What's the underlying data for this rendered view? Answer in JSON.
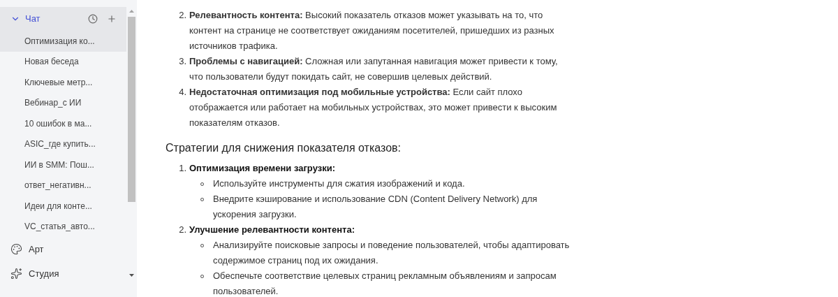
{
  "sidebar": {
    "chat": {
      "label": "Чат",
      "expanded": true,
      "items": [
        {
          "label": "Оптимизация ко...",
          "selected": true
        },
        {
          "label": "Новая беседа",
          "selected": false
        },
        {
          "label": "Ключевые метр...",
          "selected": false
        },
        {
          "label": "Вебинар_с ИИ",
          "selected": false
        },
        {
          "label": "10 ошибок в ма...",
          "selected": false
        },
        {
          "label": "ASIC_где купить...",
          "selected": false
        },
        {
          "label": "ИИ в SMM: Пош...",
          "selected": false
        },
        {
          "label": "ответ_негативн...",
          "selected": false
        },
        {
          "label": "Идеи для конте...",
          "selected": false
        },
        {
          "label": "VC_статья_авто...",
          "selected": false
        }
      ]
    },
    "sections": [
      {
        "kind": "art",
        "label": "Арт"
      },
      {
        "kind": "studio",
        "label": "Студия"
      }
    ]
  },
  "content": {
    "causes": [
      {
        "number": "2.",
        "text": "**Релевантность контента:** Высокий показатель отказов может указывать на то, что контент на странице не соответствует ожиданиям посетителей, пришедших из разных источников трафика."
      },
      {
        "number": "3.",
        "text": "**Проблемы с навигацией:** Сложная или запутанная навигация может привести к тому, что пользователи будут покидать сайт, не совершив целевых действий."
      },
      {
        "number": "4.",
        "text": "**Недостаточная оптимизация под мобильные устройства:** Если сайт плохо отображается или работает на мобильных устройствах, это может привести к высоким показателям отказов."
      }
    ],
    "heading": "Стратегии для снижения показателя отказов:",
    "strategies": [
      {
        "number": "1.",
        "title": "Оптимизация времени загрузки:",
        "points": [
          "Используйте инструменты для сжатия изображений и кода.",
          "Внедрите кэширование и использование CDN (Content Delivery Network) для ускорения загрузки."
        ]
      },
      {
        "number": "2.",
        "title": "Улучшение релевантности контента:",
        "points": [
          "Анализируйте поисковые запросы и поведение пользователей, чтобы адаптировать содержимое страниц под их ожидания.",
          "Обеспечьте соответствие целевых страниц рекламным объявлениям и запросам пользователей."
        ]
      }
    ]
  }
}
